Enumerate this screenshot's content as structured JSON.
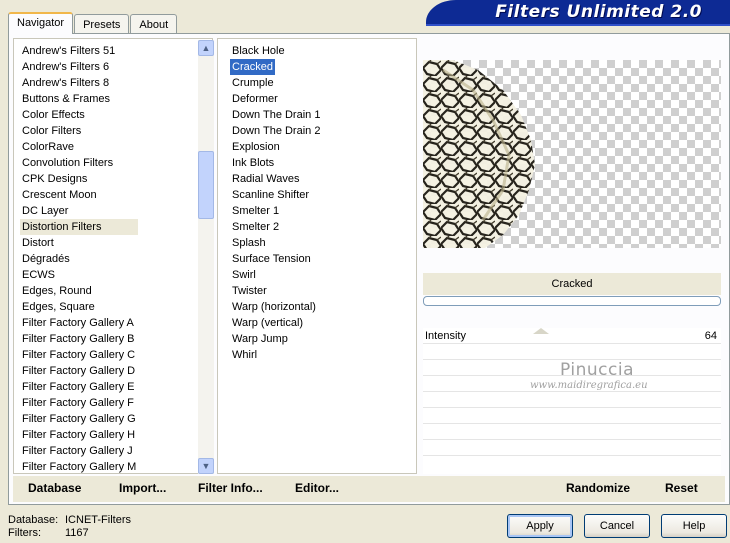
{
  "tabs": [
    "Navigator",
    "Presets",
    "About"
  ],
  "app_title": "Filters Unlimited 2.0",
  "categories": [
    "Andrew's Filters 51",
    "Andrew's Filters 6",
    "Andrew's Filters 8",
    "Buttons & Frames",
    "Color Effects",
    "Color Filters",
    "ColorRave",
    "Convolution Filters",
    "CPK Designs",
    "Crescent Moon",
    "DC Layer",
    "Distortion Filters",
    "Distort",
    "Dégradés",
    "ECWS",
    "Edges, Round",
    "Edges, Square",
    "Filter Factory Gallery A",
    "Filter Factory Gallery B",
    "Filter Factory Gallery C",
    "Filter Factory Gallery D",
    "Filter Factory Gallery E",
    "Filter Factory Gallery F",
    "Filter Factory Gallery G",
    "Filter Factory Gallery H",
    "Filter Factory Gallery J",
    "Filter Factory Gallery M"
  ],
  "selected_category_index": 11,
  "filters": [
    "Black Hole",
    "Cracked",
    "Crumple",
    "Deformer",
    "Down The Drain 1",
    "Down The Drain 2",
    "Explosion",
    "Ink Blots",
    "Radial Waves",
    "Scanline Shifter",
    "Smelter 1",
    "Smelter 2",
    "Splash",
    "Surface Tension",
    "Swirl",
    "Twister",
    "Warp (horizontal)",
    "Warp (vertical)",
    "Warp Jump",
    "Whirl"
  ],
  "selected_filter_index": 1,
  "current_filter": "Cracked",
  "params": [
    {
      "label": "Intensity",
      "value": "64",
      "level": 64,
      "max": 255
    }
  ],
  "watermark": {
    "name": "Pinuccia",
    "site": "www.maidiregrafica.eu"
  },
  "bottom_bar": {
    "database": "Database",
    "import": "Import...",
    "filter_info": "Filter Info...",
    "editor": "Editor...",
    "randomize": "Randomize",
    "reset": "Reset"
  },
  "footer": {
    "database_label": "Database:",
    "database_value": "ICNET-Filters",
    "filters_label": "Filters:",
    "filters_value": "1167"
  },
  "buttons": {
    "apply": "Apply",
    "cancel": "Cancel",
    "help": "Help"
  },
  "colors": {
    "selection": "#316ac5",
    "banner": "#0d2a94",
    "accent_tab": "#f1b74a"
  }
}
